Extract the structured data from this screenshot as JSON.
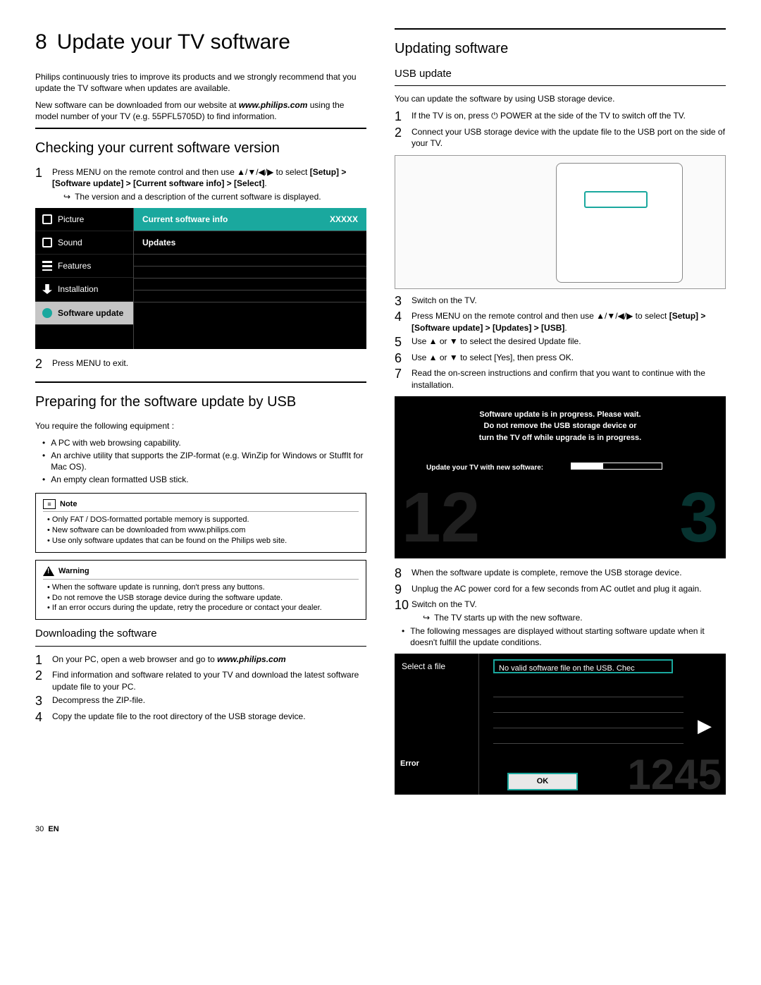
{
  "chapter": {
    "num": "8",
    "title": "Update your TV software"
  },
  "intro1": "Philips continuously tries to improve its products and we strongly recommend that you update the TV software when updates are available.",
  "intro2a": "New software can be downloaded from our website at ",
  "intro2_url": "www.philips.com",
  "intro2b": " using the model number of your TV (e.g. 55PFL5705D) to find information.",
  "secA": {
    "title": "Checking your current software version"
  },
  "secA_step1a": "Press MENU on the remote control and then use ▲/▼/◀/▶ to select ",
  "secA_step1b": "[Setup] > [Software update] > [Current software info] > [Select]",
  "secA_step1c": ".",
  "secA_step1_sub": "The version and a description of the current software is displayed.",
  "secA_step2": "Press MENU to exit.",
  "tv1": {
    "side": [
      "Picture",
      "Sound",
      "Features",
      "Installation",
      "Software update"
    ],
    "row1a": "Current software info",
    "row1b": "XXXXX",
    "row2": "Updates"
  },
  "secB": {
    "title": "Preparing for the software update by USB"
  },
  "secB_intro": "You require the following equipment :",
  "secB_bullets": [
    "A PC with web browsing capability.",
    "An archive utility that supports the ZIP-format (e.g. WinZip for Windows or StuffIt for Mac OS).",
    "An empty clean formatted USB stick."
  ],
  "note": {
    "label": "Note",
    "items": [
      "Only FAT / DOS-formatted portable memory is supported.",
      "New software can be downloaded from www.philips.com",
      "Use only software updates that can be found on the Philips web site."
    ]
  },
  "warn": {
    "label": "Warning",
    "items": [
      "When the software update is running, don't press any buttons.",
      "Do not remove the USB storage device during the software update.",
      "If an error occurs during the update, retry the procedure or contact your dealer."
    ]
  },
  "secC": {
    "title": "Downloading the software"
  },
  "secC_steps": {
    "s1a": "On your PC, open a web browser and go to ",
    "s1_url": "www.philips.com",
    "s2": "Find information and software related to your TV and download the latest software update file to your PC.",
    "s3": "Decompress the ZIP-file.",
    "s4": "Copy the update file to the root directory of the USB storage device."
  },
  "secD": {
    "title": "Updating software"
  },
  "secE": {
    "title": "USB update"
  },
  "secE_intro": "You can update the software by using USB storage device.",
  "secE_steps": {
    "s1": "If the TV is on, press ⏻ POWER at the side of the TV to switch off the TV.",
    "s2": "Connect your USB storage device with the update file to the USB port on the side of your TV.",
    "s3": "Switch on the TV.",
    "s4a": "Press MENU on the remote control and then use ▲/▼/◀/▶ to select ",
    "s4b": "[Setup] > [Software update] > [Updates] > [USB]",
    "s4c": ".",
    "s5": "Use ▲ or ▼ to select the desired Update file.",
    "s6": "Use ▲ or ▼ to select [Yes], then press OK.",
    "s7": "Read the on-screen instructions and confirm that you want to continue with the installation.",
    "s8": "When the software update is complete, remove the USB storage device.",
    "s9": "Unplug the AC power cord for a few seconds from AC outlet and plug it again.",
    "s10": "Switch on the TV.",
    "s10_sub": "The TV starts up with the new software.",
    "after_bullet": "The following messages are displayed without starting software update when it doesn't fulfill the update conditions."
  },
  "tv2": {
    "line1": "Software update is in progress. Please wait.",
    "line2": "Do not remove the USB storage device or",
    "line3": "turn the TV off while upgrade is in progress.",
    "plabel": "Update your TV with new software:",
    "bigL": "12",
    "bigR": "3"
  },
  "tv3": {
    "side": "Select a file",
    "msg": "No valid software file on the USB. Chec",
    "err": "Error",
    "ok": "OK",
    "big": "1245"
  },
  "footer": {
    "page": "30",
    "lang": "EN"
  }
}
